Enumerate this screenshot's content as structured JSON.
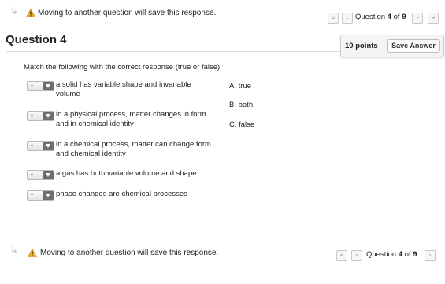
{
  "notice": {
    "text": "Moving to another question will save this response."
  },
  "nav": {
    "prefix": "Question",
    "current": "4",
    "of": "of",
    "total": "9",
    "first_icon": "«",
    "prev_icon": "‹",
    "next_icon": "›",
    "last_icon": "»"
  },
  "question": {
    "title": "Question 4",
    "points": "10 points",
    "save_label": "Save Answer",
    "instructions": "Match the following with the correct response (true or false)"
  },
  "items": [
    {
      "select_value": "-",
      "line1": "a solid has variable shape and invariable",
      "line2": "volume"
    },
    {
      "select_value": "-",
      "line1": "in a physical process, matter changes in form",
      "line2": "and in chemical identity"
    },
    {
      "select_value": "-",
      "line1": "in a chemical process, matter can change form",
      "line2": "and chemical identity"
    },
    {
      "select_value": "-",
      "line1": "a gas has both variable volume and shape",
      "line2": ""
    },
    {
      "select_value": "-",
      "line1": "phase changes are chemical processes",
      "line2": ""
    }
  ],
  "options": [
    "A. true",
    "B. both",
    "C. false"
  ],
  "colors": {
    "warning": "#f0a92a",
    "select_button": "#6e6e6e"
  }
}
